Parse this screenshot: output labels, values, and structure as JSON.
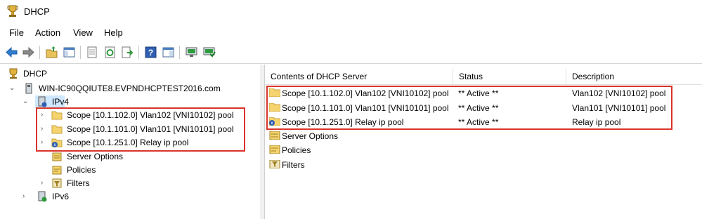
{
  "window": {
    "title": "DHCP"
  },
  "menu": [
    "File",
    "Action",
    "View",
    "Help"
  ],
  "toolbar": {
    "buttons": [
      "back-arrow-icon",
      "forward-arrow-icon",
      "up-folder-icon",
      "show-hide-console-tree-icon",
      "properties-icon",
      "refresh-icon",
      "export-list-icon",
      "help-icon",
      "show-hide-action-pane-icon",
      "server-icon",
      "authorize-server-icon"
    ]
  },
  "tree": {
    "root": "DHCP",
    "server": "WIN-IC90QQIUTE8.EVPNDHCPTEST2016.com",
    "ipv4": "IPv4",
    "scopes": [
      "Scope [10.1.102.0] Vlan102 [VNI10102] pool",
      "Scope [10.1.101.0] Vlan101 [VNI10101] pool",
      "Scope [10.1.251.0] Relay ip pool"
    ],
    "server_options": "Server Options",
    "policies": "Policies",
    "filters": "Filters",
    "ipv6": "IPv6"
  },
  "list": {
    "columns": [
      "Contents of DHCP Server",
      "Status",
      "Description"
    ],
    "rows": [
      {
        "name": "Scope [10.1.102.0] Vlan102 [VNI10102] pool",
        "status": "** Active **",
        "description": "Vlan102 [VNI10102] pool"
      },
      {
        "name": "Scope [10.1.101.0] Vlan101 [VNI10101] pool",
        "status": "** Active **",
        "description": "Vlan101 [VNI10101] pool"
      },
      {
        "name": "Scope [10.1.251.0] Relay ip pool",
        "status": "** Active **",
        "description": "Relay ip pool"
      }
    ],
    "extra_items": [
      "Server Options",
      "Policies",
      "Filters"
    ]
  },
  "colors": {
    "highlight": "#d9342b",
    "selection": "#cde8ff",
    "folder": "#f5d46f"
  }
}
